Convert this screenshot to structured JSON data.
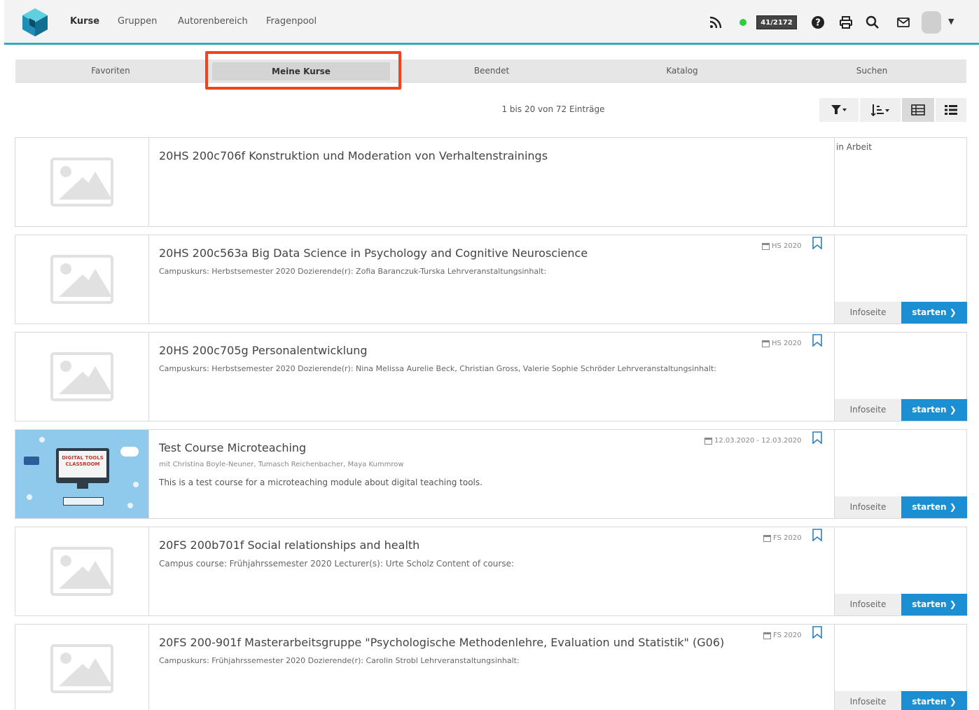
{
  "nav": {
    "items": [
      {
        "label": "Kurse",
        "active": true
      },
      {
        "label": "Gruppen",
        "active": false
      },
      {
        "label": "Autorenbereich",
        "active": false
      },
      {
        "label": "Fragenpool",
        "active": false
      }
    ],
    "counter": "41/2172"
  },
  "tabs": [
    {
      "label": "Favoriten",
      "active": false
    },
    {
      "label": "Meine Kurse",
      "active": true
    },
    {
      "label": "Beendet",
      "active": false
    },
    {
      "label": "Katalog",
      "active": false
    },
    {
      "label": "Suchen",
      "active": false
    }
  ],
  "toolbar": {
    "paging": "1 bis 20 von 72 Einträge"
  },
  "courses": [
    {
      "title": "20HS 200c706f Konstruktion und Moderation von Verhaltenstrainings",
      "description": "",
      "semester": "",
      "status": "in Arbeit",
      "info_label": "",
      "start_label": ""
    },
    {
      "title": "20HS 200c563a Big Data Science in Psychology and Cognitive Neuroscience",
      "description": "Campuskurs: Herbstsemester 2020 Dozierende(r): Zofia Baranczuk-Turska Lehrveranstaltungsinhalt:",
      "semester": "HS 2020",
      "status": "",
      "info_label": "Infoseite",
      "start_label": "starten"
    },
    {
      "title": "20HS 200c705g Personalentwicklung",
      "description": "Campuskurs: Herbstsemester 2020 Dozierende(r): Nina Melissa Aurelie Beck, Christian Gross, Valerie Sophie Schröder Lehrveranstaltungsinhalt:",
      "semester": "HS 2020",
      "status": "",
      "info_label": "Infoseite",
      "start_label": "starten"
    },
    {
      "title": "Test Course Microteaching",
      "authors": "mit Christina Boyle-Neuner, Tumasch Reichenbacher, Maya Kummrow",
      "description": "This is a test course for a microteaching module about digital teaching tools.",
      "semester": "12.03.2020 - 12.03.2020",
      "status": "",
      "info_label": "Infoseite",
      "start_label": "starten",
      "thumb_text": "DIGITAL TOOLS CLASSROOM"
    },
    {
      "title": "20FS 200b701f Social relationships and health",
      "description": "Campus course: Frühjahrssemester 2020 Lecturer(s): Urte Scholz Content of course:",
      "semester": "FS 2020",
      "status": "",
      "info_label": "Infoseite",
      "start_label": "starten"
    },
    {
      "title": "20FS 200-901f Masterarbeitsgruppe \"Psychologische Methodenlehre, Evaluation und Statistik\" (G06)",
      "description": "Campuskurs: Frühjahrssemester 2020 Dozierende(r): Carolin Strobl Lehrveranstaltungsinhalt:",
      "semester": "FS 2020",
      "status": "",
      "info_label": "Infoseite",
      "start_label": "starten"
    }
  ],
  "colors": {
    "accent": "#3aa9b7",
    "start_button": "#1b8fd2",
    "highlight": "#f2431c",
    "online": "#2ecc40"
  }
}
